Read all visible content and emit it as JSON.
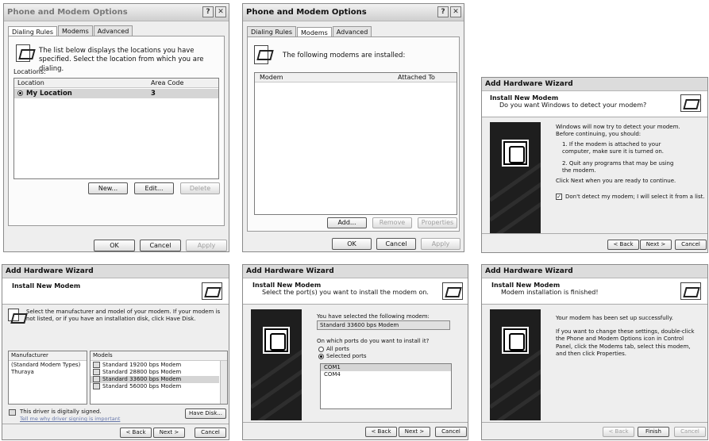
{
  "w1": {
    "title": "Phone and Modem Options",
    "help": "?",
    "close": "✕",
    "tabs": [
      "Dialing Rules",
      "Modems",
      "Advanced"
    ],
    "info": "The list below displays the locations you have specified. Select the location from which you are dialing.",
    "locations_label": "Locations:",
    "col_location": "Location",
    "col_area": "Area Code",
    "row_location": "My Location",
    "row_area": "3",
    "new": "New...",
    "edit": "Edit...",
    "delete": "Delete",
    "ok": "OK",
    "cancel": "Cancel",
    "apply": "Apply"
  },
  "w2": {
    "title": "Phone and Modem Options",
    "help": "?",
    "close": "✕",
    "tabs": [
      "Dialing Rules",
      "Modems",
      "Advanced"
    ],
    "info": "The following modems are installed:",
    "col_modem": "Modem",
    "col_attached": "Attached To",
    "add": "Add...",
    "remove": "Remove",
    "properties": "Properties",
    "ok": "OK",
    "cancel": "Cancel",
    "apply": "Apply"
  },
  "w3": {
    "title": "Add Hardware Wizard",
    "header": "Install New Modem",
    "subheader": "Do you want Windows to detect your modem?",
    "p1": "Windows will now try to detect your modem. Before continuing, you should:",
    "s1": "1.  If the modem is attached to your computer, make sure it is turned on.",
    "s2": "2.  Quit any programs that may be using the modem.",
    "p2": "Click Next when you are ready to continue.",
    "check": "Don't detect my modem; I will select it from a list.",
    "back": "< Back",
    "next": "Next >",
    "cancel": "Cancel"
  },
  "w4": {
    "title": "Add Hardware Wizard",
    "header": "Install New Modem",
    "info": "Select the manufacturer and model of your modem. If your modem is not listed, or if you have an installation disk, click Have Disk.",
    "col_manufacturer": "Manufacturer",
    "col_models": "Models",
    "manufacturers": [
      "(Standard Modem Types)",
      "Thuraya"
    ],
    "models": [
      "Standard 19200 bps Modem",
      "Standard 28800 bps Modem",
      "Standard 33600 bps Modem",
      "Standard 56000 bps Modem"
    ],
    "signed": "This driver is digitally signed.",
    "signing_link": "Tell me why driver signing is important",
    "have_disk": "Have Disk...",
    "back": "< Back",
    "next": "Next >",
    "cancel": "Cancel"
  },
  "w5": {
    "title": "Add Hardware Wizard",
    "header": "Install New Modem",
    "subheader": "Select the port(s) you want to install the modem on.",
    "p1": "You have selected the following modem:",
    "modem": "Standard 33600 bps Modem",
    "p2": "On which ports do you want to install it?",
    "all_ports": "All ports",
    "selected_ports": "Selected ports",
    "ports": [
      "COM1",
      "COM4"
    ],
    "back": "< Back",
    "next": "Next >",
    "cancel": "Cancel"
  },
  "w6": {
    "title": "Add Hardware Wizard",
    "header": "Install New Modem",
    "subheader": "Modem installation is finished!",
    "p1": "Your modem has been set up successfully.",
    "p2": "If you want to change these settings, double-click the Phone and Modem Options icon in Control Panel, click the Modems tab, select this modem, and then click Properties.",
    "back": "< Back",
    "finish": "Finish",
    "cancel": "Cancel"
  }
}
